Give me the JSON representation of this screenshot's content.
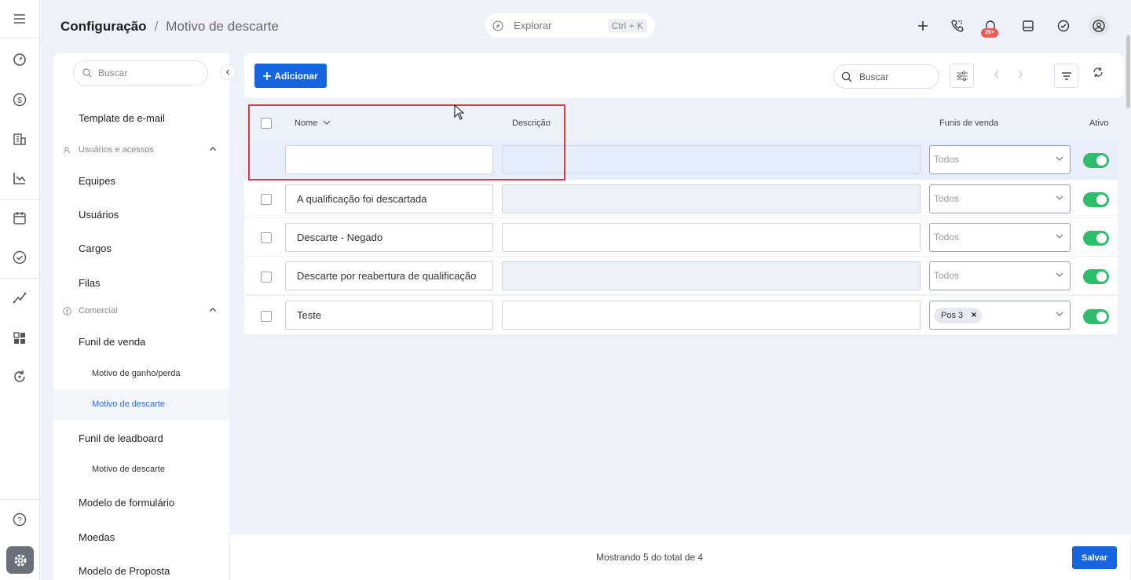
{
  "header": {
    "breadcrumb_root": "Configuração",
    "breadcrumb_sep": "/",
    "breadcrumb_current": "Motivo de descarte",
    "explore_label": "Explorar",
    "explore_shortcut": "Ctrl + K",
    "notification_count": "20+"
  },
  "sidebar": {
    "search_placeholder": "Buscar",
    "items": [
      {
        "label": "Template de e-mail"
      },
      {
        "label": "Usuários e acessos"
      },
      {
        "label": "Equipes"
      },
      {
        "label": "Usuários"
      },
      {
        "label": "Cargos"
      },
      {
        "label": "Filas"
      },
      {
        "label": "Comercial"
      },
      {
        "label": "Funil de venda"
      },
      {
        "label": "Motivo de ganho/perda"
      },
      {
        "label": "Motivo de descarte"
      },
      {
        "label": "Funil de leadboard"
      },
      {
        "label": "Motivo de descarte"
      },
      {
        "label": "Modelo de formulário"
      },
      {
        "label": "Moedas"
      },
      {
        "label": "Modelo de Proposta"
      }
    ]
  },
  "toolbar": {
    "add_label": "Adicionar",
    "search_placeholder": "Buscar"
  },
  "table": {
    "columns": {
      "name": "Nome",
      "description": "Descrição",
      "funnels": "Funis de venda",
      "active": "Ativo"
    },
    "rows": [
      {
        "name": "",
        "funnel": "Todos",
        "active": true
      },
      {
        "name": "A qualificação foi descartada",
        "funnel": "Todos",
        "active": true
      },
      {
        "name": "Descarte - Negado",
        "funnel": "Todos",
        "active": true
      },
      {
        "name": "Descarte por reabertura de qualificação",
        "funnel": "Todos",
        "active": true
      },
      {
        "name": "Teste",
        "funnel_chip": "Pos 3",
        "active": true
      }
    ]
  },
  "footer": {
    "status": "Mostrando 5 do total de 4",
    "save_label": "Salvar"
  },
  "colors": {
    "accent": "#1565e0",
    "toggle_on": "#2cbe6a",
    "highlight_box": "#dc3a3a",
    "active_nav": "#2d6fd8"
  }
}
